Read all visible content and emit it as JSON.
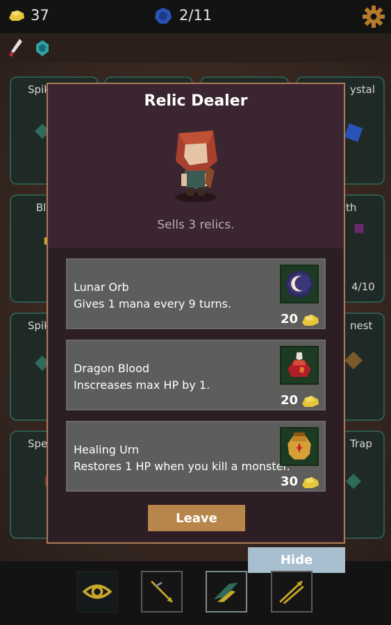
{
  "hud": {
    "gold": "37",
    "mana": "2/11",
    "icons": [
      "gold-icon",
      "mana-crystal-icon",
      "gear-icon"
    ]
  },
  "board": {
    "tiles_visible_labels": [
      "Spik",
      "ystal",
      "Bl",
      "th",
      "4/10",
      "Spik",
      "nest",
      "Spea",
      "Trap"
    ]
  },
  "modal": {
    "title": "Relic Dealer",
    "subtitle": "Sells 3 relics.",
    "items": [
      {
        "name": "Lunar Orb",
        "description": "Gives 1 mana every 9 turns.",
        "price": "20",
        "icon": "moon-orb-icon"
      },
      {
        "name": "Dragon Blood",
        "description": "Inscreases max HP by 1.",
        "price": "20",
        "icon": "potion-icon"
      },
      {
        "name": "Healing Urn",
        "description": "Restores 1 HP when you kill a monster.",
        "price": "30",
        "icon": "urn-icon"
      }
    ],
    "leave_label": "Leave"
  },
  "hide_label": "Hide",
  "abilities": [
    "eye-ability-icon",
    "arrow-ability-icon",
    "wing-ability-icon",
    "triple-arrow-ability-icon"
  ],
  "colors": {
    "accent_gold": "#b8864a",
    "modal_border": "#b07a5a",
    "hide_button": "#a8bfcf",
    "item_bg": "#5d5d5b"
  }
}
